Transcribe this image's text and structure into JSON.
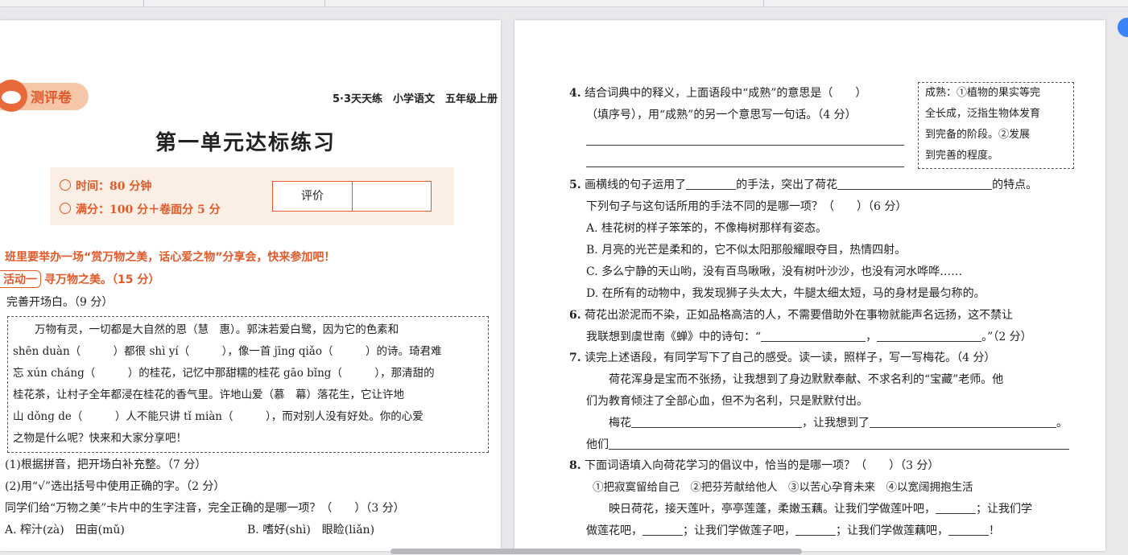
{
  "left_page": {
    "badge_label": "测评卷",
    "header_right": "5·3天天练　小学语文　五年级上册",
    "title": "第一单元达标练习",
    "time_label": "时间：80 分钟",
    "score_label": "满分：100 分＋卷面分 5 分",
    "eval_label": "评价",
    "intro": "班里要举办一场“赏万物之美，话心爱之物”分享会，快来参加吧！",
    "activity_tag": "活动一",
    "activity_text": "寻万物之美。（15 分）",
    "q1": "完善开场白。（9 分）",
    "box_lines": [
      "　　万物有灵，一切都是大自然的恩（慧　惠）。郭沫若爱白鹭，因为它的色素和",
      "shēn duàn（　　　）都很 shì yí（　　　），像一首 jīng qiǎo（　　　）的诗。琦君难",
      "忘 xún cháng（　　　）的桂花，记忆中那甜糯的桂花 gāo bǐng（　　　），那清甜的",
      "桂花茶，让村子全年都浸在桂花的香气里。许地山爱（慕　幕）落花生，它让许地",
      "山 dǒng de（　　　）人不能只讲 tǐ miàn（　　　），而对别人没有好处。你的心爱",
      "之物是什么呢？快来和大家分享吧！"
    ],
    "sub1": "(1)根据拼音，把开场白补充整。（7 分）",
    "sub2": "(2)用“√”选出括号中使用正确的字。（2 分）",
    "q2": "同学们给“万物之美”卡片中的生字注音，完全正确的是哪一项？（　　）（3 分）",
    "optA": "A. 榨汁(zà)　田亩(mǔ)",
    "optB": "B. 嗜好(shì)　眼睑(liǎn)"
  },
  "right_page": {
    "q4_no": "4.",
    "q4_line1": "结合词典中的释义，上面语段中“成熟”的意思是（　　）",
    "q4_line2": "（填序号），用“成熟”的另一个意思写一句话。（4 分）",
    "dict_lines": [
      "成熟：①植物的果实等完",
      "全长成，泛指生物体发育",
      "到完备的阶段。②发展",
      "到完善的程度。"
    ],
    "q5_no": "5.",
    "q5_part1": "画横线的句子运用了",
    "q5_part2": "的手法，突出了荷花",
    "q5_part3": "的特点。",
    "q5_line2": "下列句子与这句话所用的手法不同的是哪一项？（　　）（6 分）",
    "q5_options": [
      "A. 桂花树的样子笨笨的，不像梅树那样有姿态。",
      "B. 月亮的光芒是柔和的，它不似太阳那般耀眼夺目，热情四射。",
      "C. 多么宁静的天山哟，没有百鸟啾啾，没有树叶沙沙，也没有河水哗哗……",
      "D. 在所有的动物中，我发现狮子头太大，牛腿太细太短，马的身材是最匀称的。"
    ],
    "q6_no": "6.",
    "q6_line1": "荷花出淤泥而不染，正如品格高洁的人，不需要借助外在事物就能声名远扬，这不禁让",
    "q6_line2a": "我联想到虞世南《蝉》中的诗句：“",
    "q6_line2b": "，",
    "q6_line2c": "。”（2 分）",
    "q7_no": "7.",
    "q7_line1": "读完上述语段，有同学写下了自己的感受。读一读，照样子，写一写梅花。（4 分）",
    "q7_line2": "　　荷花浑身是宝而不张扬，让我想到了身边默默奉献、不求名利的“宝藏”老师。他",
    "q7_line3": "们为教育倾注了全部心血，但不为名利，只是默默付出。",
    "q7_line4a": "梅花",
    "q7_line4b": "，让我想到了",
    "q7_line4c": "。",
    "q7_line5": "他们",
    "q8_no": "8.",
    "q8_line1": "下面词语填入向荷花学习的倡议中，恰当的是哪一项？（　　）（3 分）",
    "q8_line2": "①把寂寞留给自己　②把芬芳献给他人　③以苦心孕育未来　④以宽阔拥抱生活",
    "q8_line3a": "　　映日荷花，接天莲叶，亭亭莲蓬，柔嫩玉藕。让我们学做莲叶吧，",
    "q8_line3b": "；让我们学",
    "q8_line4a": "做莲花吧，",
    "q8_line4b": "；让我们学做莲子吧，",
    "q8_line4c": "；让我们学做莲藕吧，",
    "q8_line4d": "！"
  },
  "colors": {
    "accent": "#e05a2a",
    "accent_light": "#fbeee4",
    "viewer_bg": "#e9e9ec"
  }
}
